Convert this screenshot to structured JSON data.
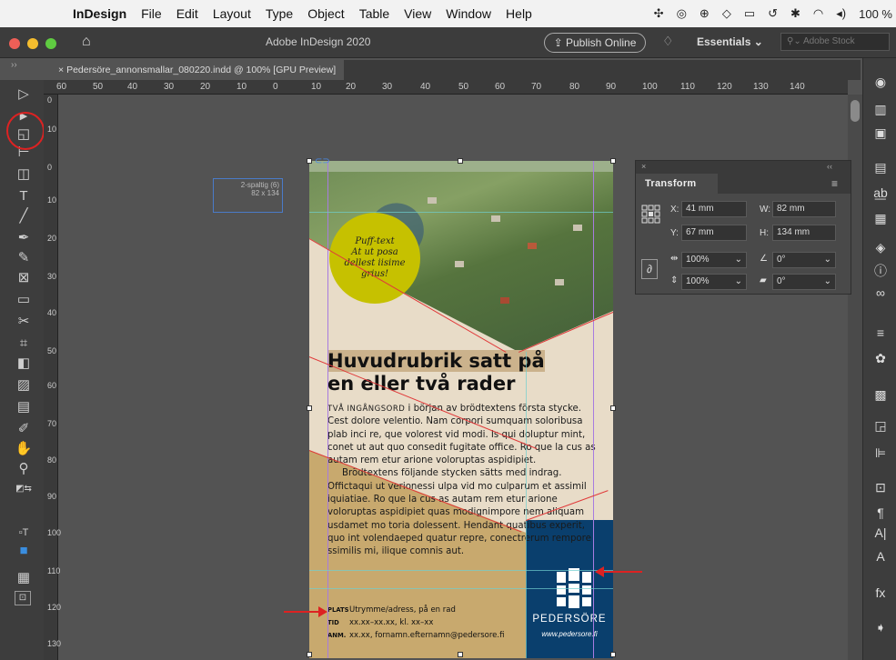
{
  "menubar": {
    "app_name": "InDesign",
    "items": [
      "File",
      "Edit",
      "Layout",
      "Type",
      "Object",
      "Table",
      "View",
      "Window",
      "Help"
    ],
    "battery": "100 %"
  },
  "window": {
    "title": "Adobe InDesign 2020",
    "publish_label": "Publish Online",
    "workspace_label": "Essentials",
    "stock_placeholder": "Adobe Stock"
  },
  "document_tab": {
    "label": "Pedersöre_annonsmallar_080220.indd @ 100% [GPU Preview]"
  },
  "ruler": {
    "h_ticks": [
      "60",
      "50",
      "40",
      "30",
      "20",
      "10",
      "0",
      "10",
      "20",
      "30",
      "40",
      "50",
      "60",
      "70",
      "80",
      "90",
      "100",
      "110",
      "120",
      "130",
      "140"
    ],
    "v_ticks": [
      "0",
      "10",
      "0",
      "10",
      "20",
      "30",
      "40",
      "50",
      "60",
      "70",
      "80",
      "90",
      "100",
      "110",
      "120",
      "130"
    ]
  },
  "frame_label": {
    "line1": "2-spaltig (6)",
    "line2": "82 x 134"
  },
  "ad": {
    "puff_lines": [
      "Puff-text",
      "At ut posa",
      "dellest iisime",
      "grius!"
    ],
    "headline_line1": "Huvudrubrik satt på",
    "headline_line2": "en eller två rader",
    "lead_smallcaps": "TVÅ INGÅNGSORD",
    "body_p1": " i början av brödtextens första stycke. Cest dolore velentio. Nam corpori sumquam soloribusa plab inci re, que volorest vid modi. Is qui doluptur mint, conet ut aut quo consedit fugitate office. Ro que la cus as autam rem etur arione voloruptas aspidipiet.",
    "body_p2": "Brödtextens följande stycken sätts med indrag. Offictaqui ut verionessi ulpa vid mo culparum et assimil iquiatiae. Ro que la cus as autam rem etur arione voloruptas aspidipiet quas modignimpore nem aliquam usdamet mo toria dolessent. Hendant quatibus experit, quo int volendaeped quatur repre, conectrerum rempore ssimilis mi, ilique comnis aut.",
    "info_rows": [
      {
        "label": "PLATS",
        "value": "Utrymme/adress, på en rad"
      },
      {
        "label": "TID",
        "value": "xx.xx–xx.xx, kl. xx–xx"
      },
      {
        "label": "ANM.",
        "value": "xx.xx, fornamn.efternamn@pedersore.fi"
      }
    ],
    "brand_name": "PEDERSÖRE",
    "brand_url": "www.pedersore.fi"
  },
  "transform_panel": {
    "title": "Transform",
    "x_label": "X:",
    "x_value": "41 mm",
    "y_label": "Y:",
    "y_value": "67 mm",
    "w_label": "W:",
    "w_value": "82 mm",
    "h_label": "H:",
    "h_value": "134 mm",
    "scale_x": "100%",
    "scale_y": "100%",
    "rotate": "0°",
    "shear": "0°"
  },
  "colors": {
    "brand_blue": "#0a3f6d",
    "puff_yellow": "#c6c100",
    "tan": "#c8a96e",
    "annotation_red": "#dd2222"
  }
}
